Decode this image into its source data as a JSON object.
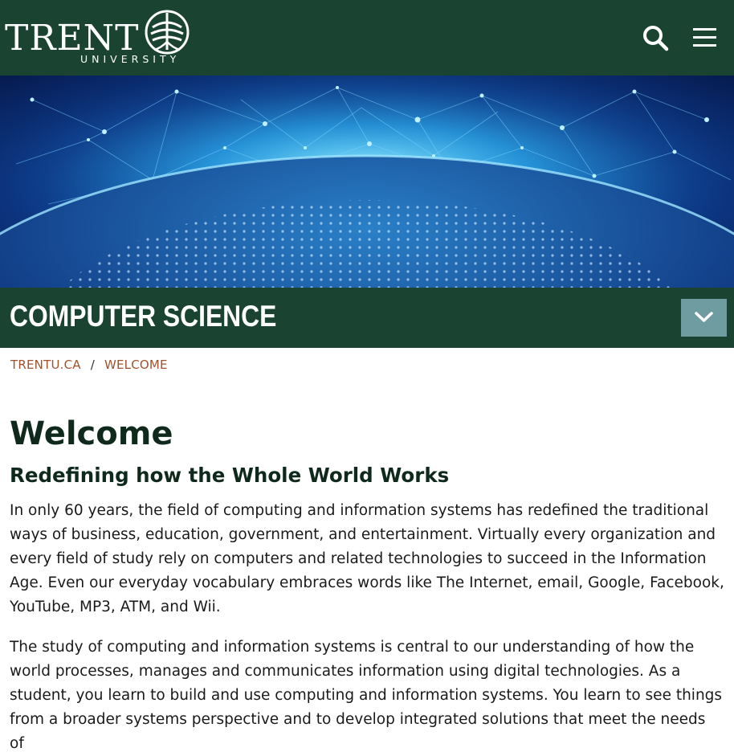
{
  "header": {
    "logo_word": "TRENT",
    "logo_sub": "UNIVERSITY",
    "logo_icon": "trent-bridge-emblem-icon",
    "search_icon": "search-icon",
    "menu_icon": "hamburger-menu-icon"
  },
  "section": {
    "title": "COMPUTER SCIENCE",
    "toggle_icon": "chevron-down-icon"
  },
  "breadcrumb": {
    "home": "TRENTU.CA",
    "separator": "/",
    "current": "WELCOME"
  },
  "main": {
    "title": "Welcome",
    "subtitle": "Redefining how the Whole World Works",
    "paragraphs": [
      "In only 60 years, the field of computing and information systems has redefined the traditional ways of business, education, government, and entertainment.  Virtually every organization and every field of study rely on computers and related technologies to succeed in the Information Age.  Even our everyday vocabulary embraces words like The Internet, email, Google, Facebook, YouTube, MP3, ATM, and Wii.",
      "The study of computing and information systems is central to our understanding of how the world processes, manages and communicates information using digital technologies.  As a student, you learn to build and use computing and information systems.  You learn to see things from a broader systems perspective and to develop integrated solutions that meet the needs of"
    ]
  },
  "colors": {
    "header_green": "#1b4332",
    "toggle_teal": "#6f9ca0",
    "breadcrumb_link": "#a0522d",
    "heading": "#0f2a1d"
  }
}
